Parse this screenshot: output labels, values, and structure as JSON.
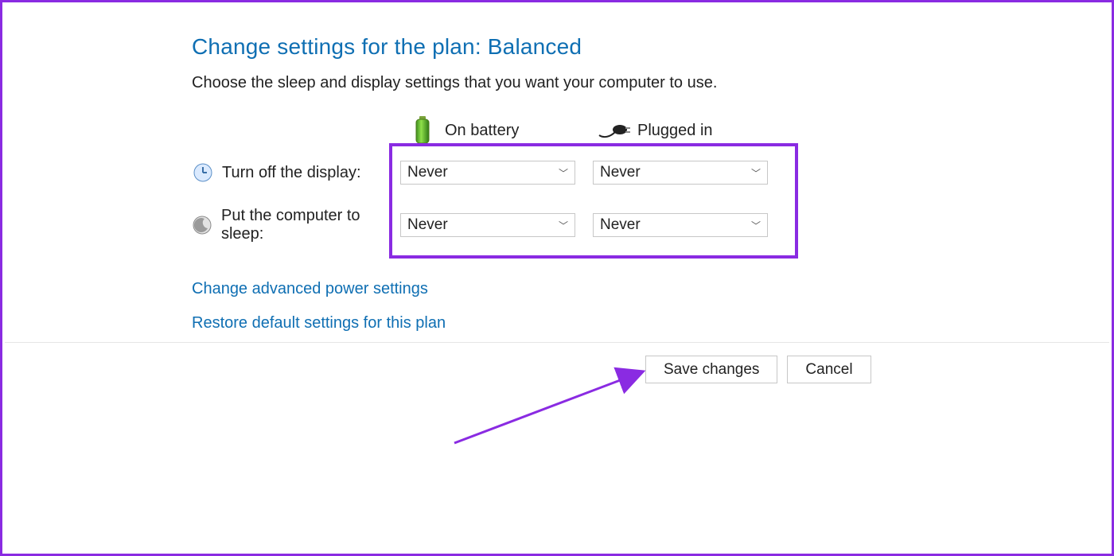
{
  "title": "Change settings for the plan: Balanced",
  "subtitle": "Choose the sleep and display settings that you want your computer to use.",
  "columns": {
    "battery_label": "On battery",
    "plugged_label": "Plugged in"
  },
  "rows": {
    "display_off": {
      "label": "Turn off the display:",
      "battery_value": "Never",
      "plugged_value": "Never"
    },
    "sleep": {
      "label": "Put the computer to sleep:",
      "battery_value": "Never",
      "plugged_value": "Never"
    }
  },
  "links": {
    "advanced": "Change advanced power settings",
    "restore": "Restore default settings for this plan"
  },
  "buttons": {
    "save": "Save changes",
    "cancel": "Cancel"
  }
}
